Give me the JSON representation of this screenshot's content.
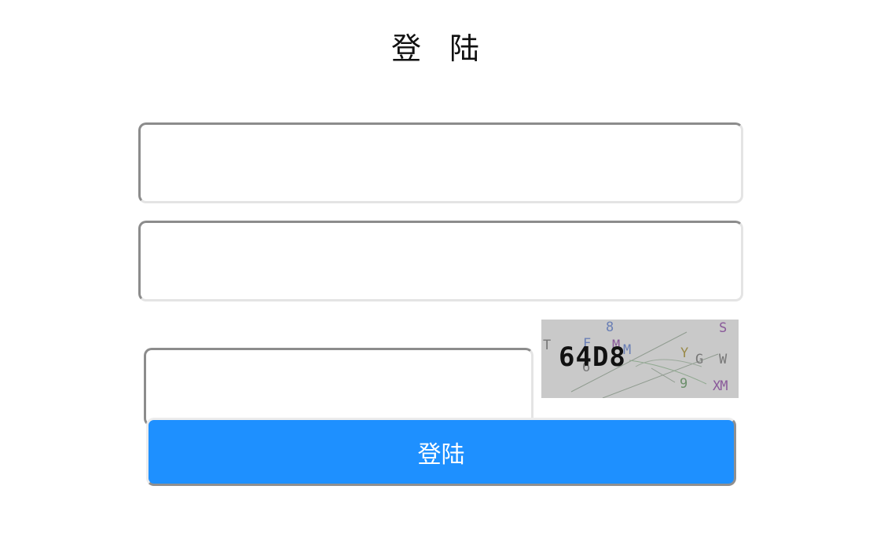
{
  "page": {
    "title": "登 陆"
  },
  "form": {
    "username": {
      "value": "",
      "placeholder": ""
    },
    "password": {
      "value": "",
      "placeholder": ""
    },
    "captcha_input": {
      "value": "",
      "placeholder": ""
    },
    "submit_label": "登陆"
  },
  "captcha": {
    "code": "64D8",
    "noise_chars": [
      "T",
      "F",
      "8",
      "M",
      "M",
      "Y",
      "G",
      "W",
      "S",
      "9",
      "XM",
      "6"
    ],
    "colors": {
      "background": "#c9c9c9",
      "noise_gray": "#777777",
      "noise_blue": "#6a7fb5",
      "noise_purple": "#8a5a9a",
      "noise_green": "#6b8f6b",
      "noise_olive": "#9a8a4a"
    }
  },
  "colors": {
    "button": "#1e90ff",
    "button_text": "#ffffff",
    "page_background": "#ffffff"
  }
}
